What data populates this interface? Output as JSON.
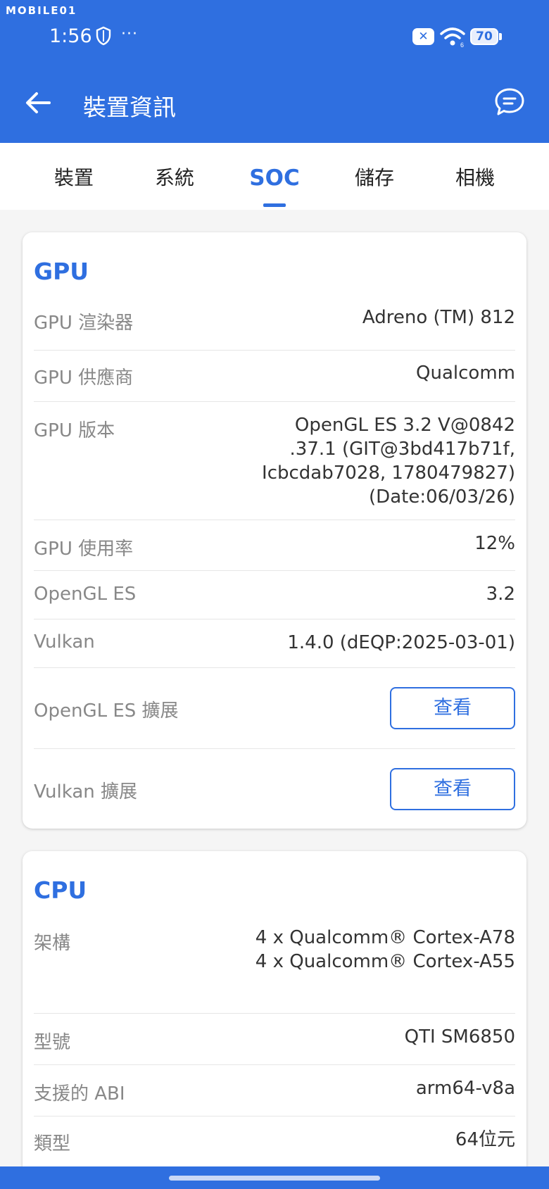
{
  "status_bar": {
    "watermark": "MOBILE01",
    "time": "1:56",
    "more": "···",
    "x_badge": "✕",
    "battery": "70"
  },
  "app_bar": {
    "title": "裝置資訊"
  },
  "tabs": [
    {
      "label": "裝置"
    },
    {
      "label": "系統"
    },
    {
      "label": "SOC"
    },
    {
      "label": "儲存"
    },
    {
      "label": "相機"
    }
  ],
  "active_tab": "SOC",
  "gpu": {
    "title": "GPU",
    "renderer_label": "GPU 渲染器",
    "renderer_value": "Adreno (TM) 812",
    "vendor_label": "GPU 供應商",
    "vendor_value": "Qualcomm",
    "version_label": "GPU 版本",
    "version_lines": [
      "OpenGL ES 3.2 V@0842",
      ".37.1 (GIT@3bd417b71f,",
      "Icbcdab7028, 1780479827)",
      "(Date:06/03/26)"
    ],
    "usage_label": "GPU 使用率",
    "usage_value": "12%",
    "opengl_label": "OpenGL ES",
    "opengl_value": "3.2",
    "vulkan_label": "Vulkan",
    "vulkan_value": "1.4.0 (dEQP:2025-03-01)",
    "opengl_ext_label": "OpenGL ES 擴展",
    "opengl_ext_button": "查看",
    "vulkan_ext_label": "Vulkan 擴展",
    "vulkan_ext_button": "查看"
  },
  "cpu": {
    "title": "CPU",
    "arch_label": "架構",
    "arch_lines": [
      "4 x Qualcomm® Cortex-A78",
      "4 x Qualcomm® Cortex-A55"
    ],
    "model_label": "型號",
    "model_value": "QTI SM6850",
    "abi_label": "支援的 ABI",
    "abi_value": "arm64-v8a",
    "type_label": "類型",
    "type_value": "64位元"
  },
  "colors": {
    "accent": "#2f6fe0",
    "background": "#f5f5f5",
    "label": "#888888",
    "value": "#333333"
  }
}
